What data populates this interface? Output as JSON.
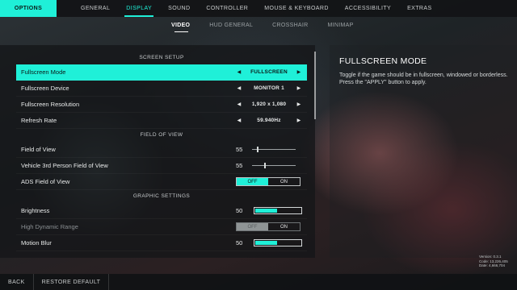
{
  "topbar": {
    "options_label": "OPTIONS",
    "tabs": [
      "GENERAL",
      "DISPLAY",
      "SOUND",
      "CONTROLLER",
      "MOUSE & KEYBOARD",
      "ACCESSIBILITY",
      "EXTRAS"
    ],
    "active_tab": "DISPLAY"
  },
  "subtabs": {
    "items": [
      "VIDEO",
      "HUD GENERAL",
      "CROSSHAIR",
      "MINIMAP"
    ],
    "active": "VIDEO"
  },
  "sections": {
    "screen_setup": "SCREEN SETUP",
    "field_of_view": "FIELD OF VIEW",
    "graphic_settings": "GRAPHIC SETTINGS"
  },
  "settings": {
    "fullscreen_mode": {
      "label": "Fullscreen Mode",
      "value": "FULLSCREEN"
    },
    "fullscreen_device": {
      "label": "Fullscreen Device",
      "value": "MONITOR 1"
    },
    "fullscreen_resolution": {
      "label": "Fullscreen Resolution",
      "value": "1,920 x 1,080"
    },
    "refresh_rate": {
      "label": "Refresh Rate",
      "value": "59.940Hz"
    },
    "field_of_view": {
      "label": "Field of View",
      "value": "55",
      "slider_fraction": 0.12
    },
    "vehicle_fov": {
      "label": "Vehicle 3rd Person Field of View",
      "value": "55",
      "slider_fraction": 0.28
    },
    "ads_fov": {
      "label": "ADS Field of View",
      "off": "OFF",
      "on": "ON",
      "selected": "OFF"
    },
    "brightness": {
      "label": "Brightness",
      "value": "50",
      "fill_fraction": 0.5
    },
    "hdr": {
      "label": "High Dynamic Range",
      "off": "OFF",
      "on": "ON",
      "selected": "OFF",
      "disabled": true
    },
    "motion_blur": {
      "label": "Motion Blur",
      "value": "50",
      "fill_fraction": 0.5
    }
  },
  "arrows": {
    "left": "◀",
    "right": "▶"
  },
  "info": {
    "title": "FULLSCREEN MODE",
    "description": "Toggle if the game should be in fullscreen, windowed or borderless. Press the \"APPLY\" button to apply."
  },
  "version": {
    "version": "Version: 0.3.1",
    "code": "Code: 13,226,405",
    "date": "Date: 4,666,704"
  },
  "bottombar": {
    "back": "BACK",
    "restore": "RESTORE DEFAULT"
  },
  "colors": {
    "accent": "#1ff0d8"
  }
}
